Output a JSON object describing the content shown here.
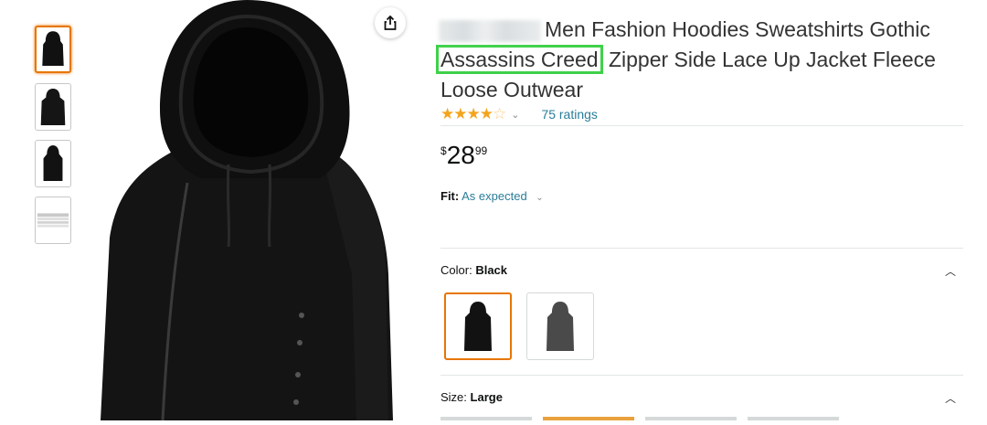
{
  "product": {
    "title_line1": "Men Fashion Hoodies Sweatshirts Gothic",
    "title_highlight": "Assassins Creed",
    "title_rest": "Zipper Side Lace Up Jacket Fleece",
    "title_line3": "Loose Outwear"
  },
  "rating": {
    "stars": 4,
    "ratings_text": "75 ratings"
  },
  "price": {
    "symbol": "$",
    "whole": "28",
    "fraction": "99"
  },
  "fit": {
    "label": "Fit:",
    "value": "As expected"
  },
  "color": {
    "label": "Color:",
    "selected": "Black",
    "swatches": [
      "Black",
      "Gray"
    ]
  },
  "size": {
    "label": "Size:",
    "selected": "Large"
  },
  "colors": {
    "highlight_border": "#3fd14a",
    "selected_border": "#e77600",
    "link": "#2a7d98",
    "star": "#f4a41c"
  },
  "icons": {
    "share": "share-icon",
    "chevron": "chevron-down-icon",
    "caret_up": "caret-up-icon"
  }
}
